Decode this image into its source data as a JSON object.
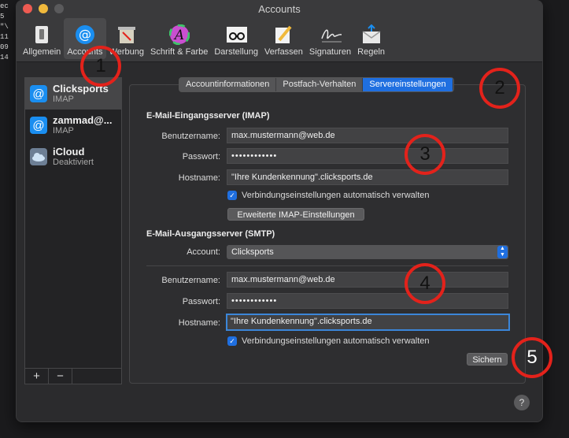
{
  "desktop_strip_text": [
    "ec",
    "",
    "5",
    "\"\\",
    "11",
    "09",
    "14"
  ],
  "window": {
    "title": "Accounts"
  },
  "toolbar": [
    {
      "label": "Allgemein",
      "icon": "switch-icon"
    },
    {
      "label": "Accounts",
      "icon": "at-icon"
    },
    {
      "label": "Werbung",
      "icon": "junk-mail-icon"
    },
    {
      "label": "Schrift & Farbe",
      "icon": "font-color-icon"
    },
    {
      "label": "Darstellung",
      "icon": "glasses-icon"
    },
    {
      "label": "Verfassen",
      "icon": "pencil-icon"
    },
    {
      "label": "Signaturen",
      "icon": "signature-icon"
    },
    {
      "label": "Regeln",
      "icon": "rules-icon"
    }
  ],
  "sidebar": {
    "accounts": [
      {
        "name": "Clicksports",
        "type": "IMAP"
      },
      {
        "name": "zammad@...",
        "type": "IMAP"
      },
      {
        "name": "iCloud",
        "type": "Deaktiviert"
      }
    ],
    "add_label": "+",
    "remove_label": "−"
  },
  "tabs": [
    "Accountinformationen",
    "Postfach-Verhalten",
    "Servereinstellungen"
  ],
  "imap": {
    "heading": "E-Mail-Eingangsserver (IMAP)",
    "username_label": "Benutzername:",
    "username": "max.mustermann@web.de",
    "password_label": "Passwort:",
    "password": "••••••••••••",
    "hostname_label": "Hostname:",
    "hostname": "\"Ihre Kundenkennung\".clicksports.de",
    "auto_label": "Verbindungseinstellungen automatisch verwalten",
    "advanced_button": "Erweiterte IMAP-Einstellungen"
  },
  "smtp": {
    "heading": "E-Mail-Ausgangsserver (SMTP)",
    "account_label": "Account:",
    "account_value": "Clicksports",
    "username_label": "Benutzername:",
    "username": "max.mustermann@web.de",
    "password_label": "Passwort:",
    "password": "••••••••••••",
    "hostname_label": "Hostname:",
    "hostname": "\"Ihre Kundenkennung\".clicksports.de",
    "auto_label": "Verbindungseinstellungen automatisch verwalten"
  },
  "save_button": "Sichern",
  "help_label": "?",
  "annotations": [
    "1",
    "2",
    "3",
    "4",
    "5"
  ],
  "colors": {
    "accent": "#1f6fe0",
    "annotation": "#e3221b"
  }
}
